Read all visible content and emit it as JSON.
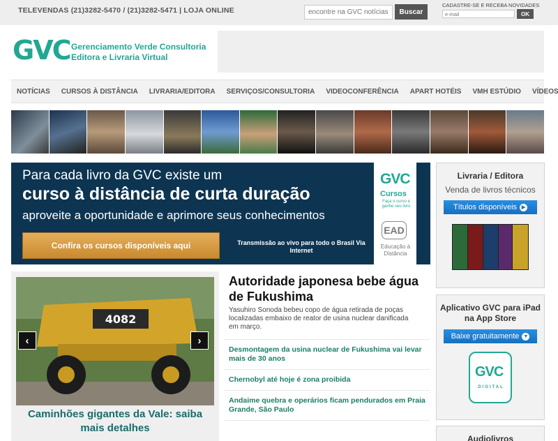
{
  "topbar": {
    "phones": "TELEVENDAS (21)3282-5470 / (21)3282-5471 | LOJA ONLINE",
    "search_placeholder": "encontre na GVC notícias",
    "search_button": "Buscar",
    "newsletter_label": "CADASTRE-SE E RECEBA NOVIDADES",
    "email_placeholder": "e-mail",
    "ok_button": "OK"
  },
  "header": {
    "logo_mark": "GVC",
    "logo_line1": "Gerenciamento Verde Consultoria",
    "logo_line2": "Editora e Livraria Virtual"
  },
  "nav": {
    "items": [
      "NOTÍCIAS",
      "CURSOS À DISTÂNCIA",
      "LIVRARIA/EDITORA",
      "SERVIÇOS/CONSULTORIA",
      "VIDEOCONFERÊNCIA",
      "APART HOTÉIS",
      "VMH ESTÚDIO",
      "VÍDEOS"
    ]
  },
  "hero": {
    "line1": "Para cada livro da GVC existe um",
    "line2": "curso à distância de curta duração",
    "line3": "aproveite a oportunidade e aprimore seus conhecimentos",
    "cta": "Confira os cursos disponíveis aqui",
    "note": "Transmissão ao vivo para todo o Brasil Via Internet",
    "side_logo": "GVC",
    "side_cursos": "Cursos",
    "side_sub": "Faça o curso e ganhe seu livro",
    "ead": "EAD",
    "ead_sub": "Educação à Distância"
  },
  "slider": {
    "truck_number": "4082",
    "caption": "Caminhões gigantes da Vale: saiba mais detalhes",
    "prev_icon": "chevron-left-icon",
    "next_icon": "chevron-right-icon"
  },
  "article": {
    "title": "Autoridade japonesa bebe água de Fukushima",
    "lead": "Yasuhiro Sonoda bebeu copo de água retirada de poças localizadas embaixo de reator de usina nuclear danificada em março.",
    "related": [
      "Desmontagem da usina nuclear de Fukushima vai levar mais de 30 anos",
      "Chernobyl até hoje é zona proibida",
      "Andaime quebra e operários ficam pendurados em Praia Grande, São Paulo"
    ]
  },
  "sidebar": {
    "box1_title": "Livraria / Editora",
    "box1_sub": "Venda de livros técnicos",
    "box1_button": "Títulos disponíveis",
    "box2_title": "Aplicativo GVC para iPad na App Store",
    "box2_button": "Baixe gratuitamente",
    "app_logo": "GVC",
    "app_sub": "DIGITAL",
    "box3_title": "Audiolivros"
  },
  "colors": {
    "brand_green": "#22a793",
    "hero_navy": "#0d3551",
    "cta_orange": "#d99a42",
    "link_green": "#1a7d67",
    "button_blue": "#1670c3"
  }
}
